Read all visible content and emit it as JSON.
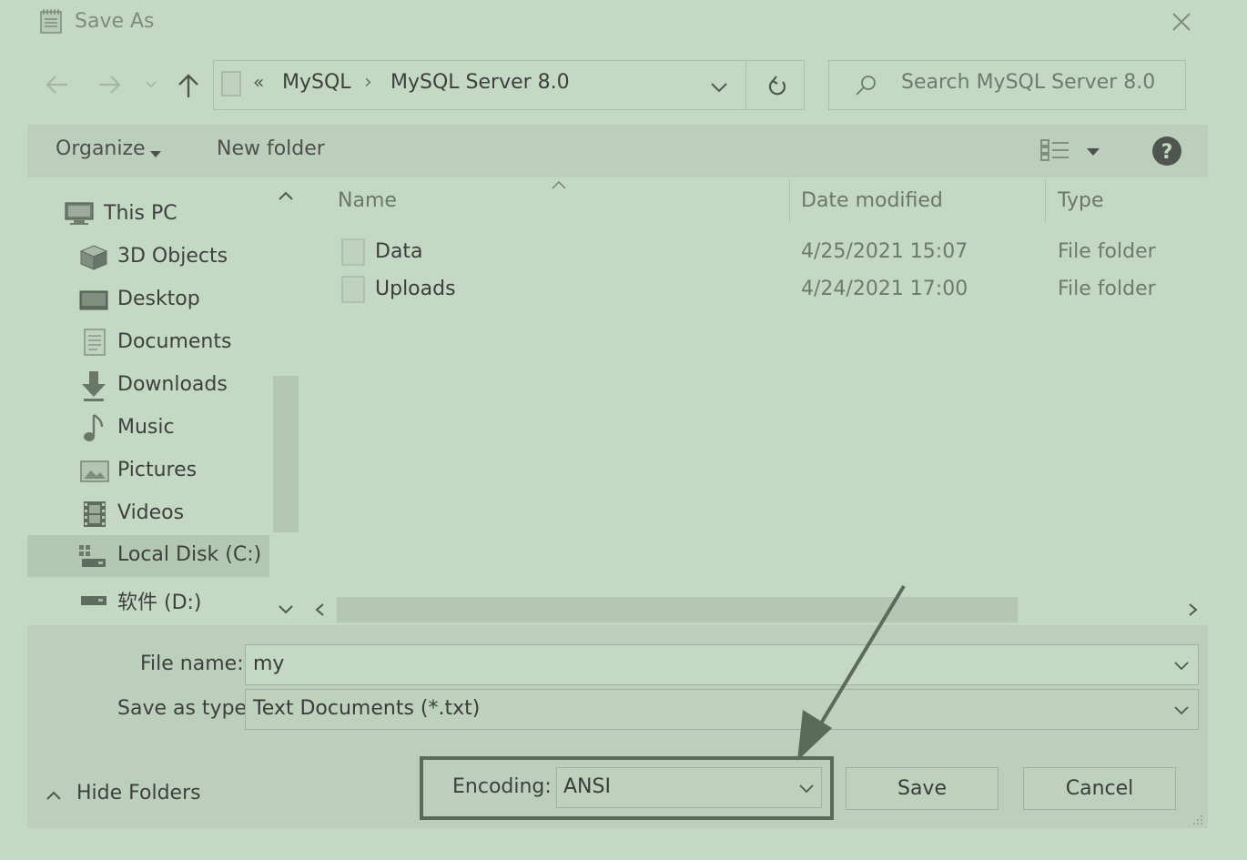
{
  "window": {
    "title": "Save As"
  },
  "navigation": {
    "breadcrumb_prefix": "«",
    "breadcrumb": [
      "MySQL",
      "MySQL Server 8.0"
    ],
    "breadcrumb_separator": "›",
    "search_placeholder": "Search MySQL Server 8.0"
  },
  "toolbar": {
    "organize_label": "Organize",
    "new_folder_label": "New folder"
  },
  "sidebar": {
    "items": [
      {
        "label": "This PC",
        "icon": "pc-icon"
      },
      {
        "label": "3D Objects",
        "icon": "cube-icon"
      },
      {
        "label": "Desktop",
        "icon": "desktop-icon"
      },
      {
        "label": "Documents",
        "icon": "document-icon"
      },
      {
        "label": "Downloads",
        "icon": "download-arrow-icon"
      },
      {
        "label": "Music",
        "icon": "music-note-icon"
      },
      {
        "label": "Pictures",
        "icon": "picture-icon"
      },
      {
        "label": "Videos",
        "icon": "film-icon"
      },
      {
        "label": "Local Disk (C:)",
        "icon": "system-drive-icon",
        "selected": true
      },
      {
        "label": "软件 (D:)",
        "icon": "drive-icon"
      }
    ]
  },
  "file_list": {
    "columns": [
      "Name",
      "Date modified",
      "Type"
    ],
    "rows": [
      {
        "name": "Data",
        "date": "4/25/2021 15:07",
        "type": "File folder"
      },
      {
        "name": "Uploads",
        "date": "4/24/2021 17:00",
        "type": "File folder"
      }
    ]
  },
  "form": {
    "file_name_label": "File name:",
    "file_name_value": "my",
    "save_type_label": "Save as type:",
    "save_type_value": "Text Documents (*.txt)",
    "encoding_label": "Encoding:",
    "encoding_value": "ANSI"
  },
  "buttons": {
    "hide_folders": "Hide Folders",
    "save": "Save",
    "cancel": "Cancel"
  },
  "colors": {
    "background": "#c4d9c4",
    "annotation": "#5b6b5b"
  }
}
